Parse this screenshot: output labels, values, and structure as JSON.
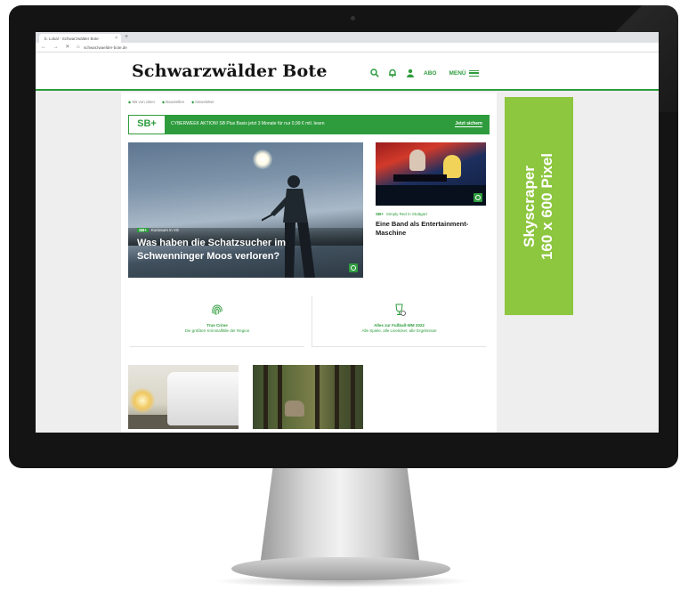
{
  "browser": {
    "tab_title": "b. Lokal - Schwarzwälder Bote",
    "tab_close": "×",
    "tab_new": "+",
    "nav": "← → ✕ ⌂",
    "url": "schwarzwaelder-bote.de"
  },
  "header": {
    "logo": "Schwarzwälder Bote",
    "abo": "ABO",
    "menu": "MENÜ",
    "icons": [
      "search-icon",
      "bell-icon",
      "user-icon",
      "menu-icon"
    ]
  },
  "top_links": [
    "SB von oben",
    "Baustellen",
    "Newsletter"
  ],
  "promo": {
    "logo": "SB+",
    "text": "CYBERWEEK AKTION! SB Plus Basis jetzt 3 Monate für nur 0,99 € mtl. lesen",
    "cta": "Jetzt sichern"
  },
  "hero": {
    "badge": "SB+",
    "kicker": "Kuriosum in VS",
    "title": "Was haben die Schatzsucher im Schwenninger Moos verloren?"
  },
  "side_article": {
    "badge": "SB+",
    "kicker": "Simply Red in Stuttgart",
    "title": "Eine Band als Entertainment-Maschine"
  },
  "teasers": [
    {
      "line1": "True Crime",
      "line2": "Die größten Kriminalfälle der Region"
    },
    {
      "line1": "Alles zur Fußball-WM 2022",
      "line2": "Alle Spiele, alle Liveticker, alle Ergebnisse"
    }
  ],
  "ad": {
    "line1": "Skyscraper",
    "line2": "160 x 600 Pixel"
  },
  "colors": {
    "brand_green": "#2e9c3d",
    "ad_green": "#8dc63f"
  }
}
